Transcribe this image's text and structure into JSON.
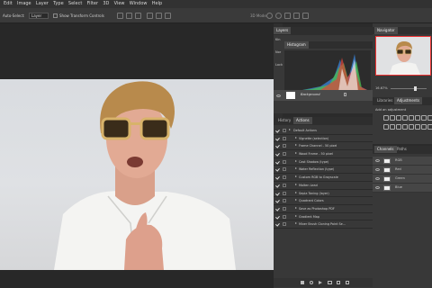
{
  "menu": [
    "Edit",
    "Image",
    "Layer",
    "Type",
    "Select",
    "Filter",
    "3D",
    "View",
    "Window",
    "Help"
  ],
  "options": {
    "auto_select": "Auto-Select:",
    "layer_value": "Layer",
    "show_transform": "Show Transform Controls",
    "mode_3d": "3D Mode:"
  },
  "layers_panel": {
    "tab": "Layers",
    "kind_label": "Kin",
    "norm_label": "Nor",
    "lock_label": "Lock",
    "layer_name": "Background"
  },
  "histogram_panel": {
    "tab": "Histogram"
  },
  "navigator": {
    "tab": "Navigator",
    "zoom": "16.67%"
  },
  "libraries": {
    "tabs": [
      "Libraries",
      "Adjustments"
    ],
    "add_label": "Add an adjustment"
  },
  "channels": {
    "tabs": [
      "Channels",
      "Paths"
    ],
    "items": [
      "RGB",
      "Red",
      "Green",
      "Blue"
    ]
  },
  "actions_panel": {
    "tabs": [
      "History",
      "Actions"
    ],
    "items": [
      "Default Actions",
      "Vignette (selection)",
      "Frame Channel - 50 pixel",
      "Wood Frame - 50 pixel",
      "Cast Shadow (type)",
      "Water Reflection (type)",
      "Custom RGB to Grayscale",
      "Molten Lead",
      "Sepia Toning (layer)",
      "Quadrant Colors",
      "Save as Photoshop PDF",
      "Gradient Map",
      "Mixer Brush Cloning Paint Se..."
    ]
  },
  "colors": {
    "accent": "#1e79d6",
    "panel_bg": "#383838",
    "canvas_bg": "#282828"
  }
}
